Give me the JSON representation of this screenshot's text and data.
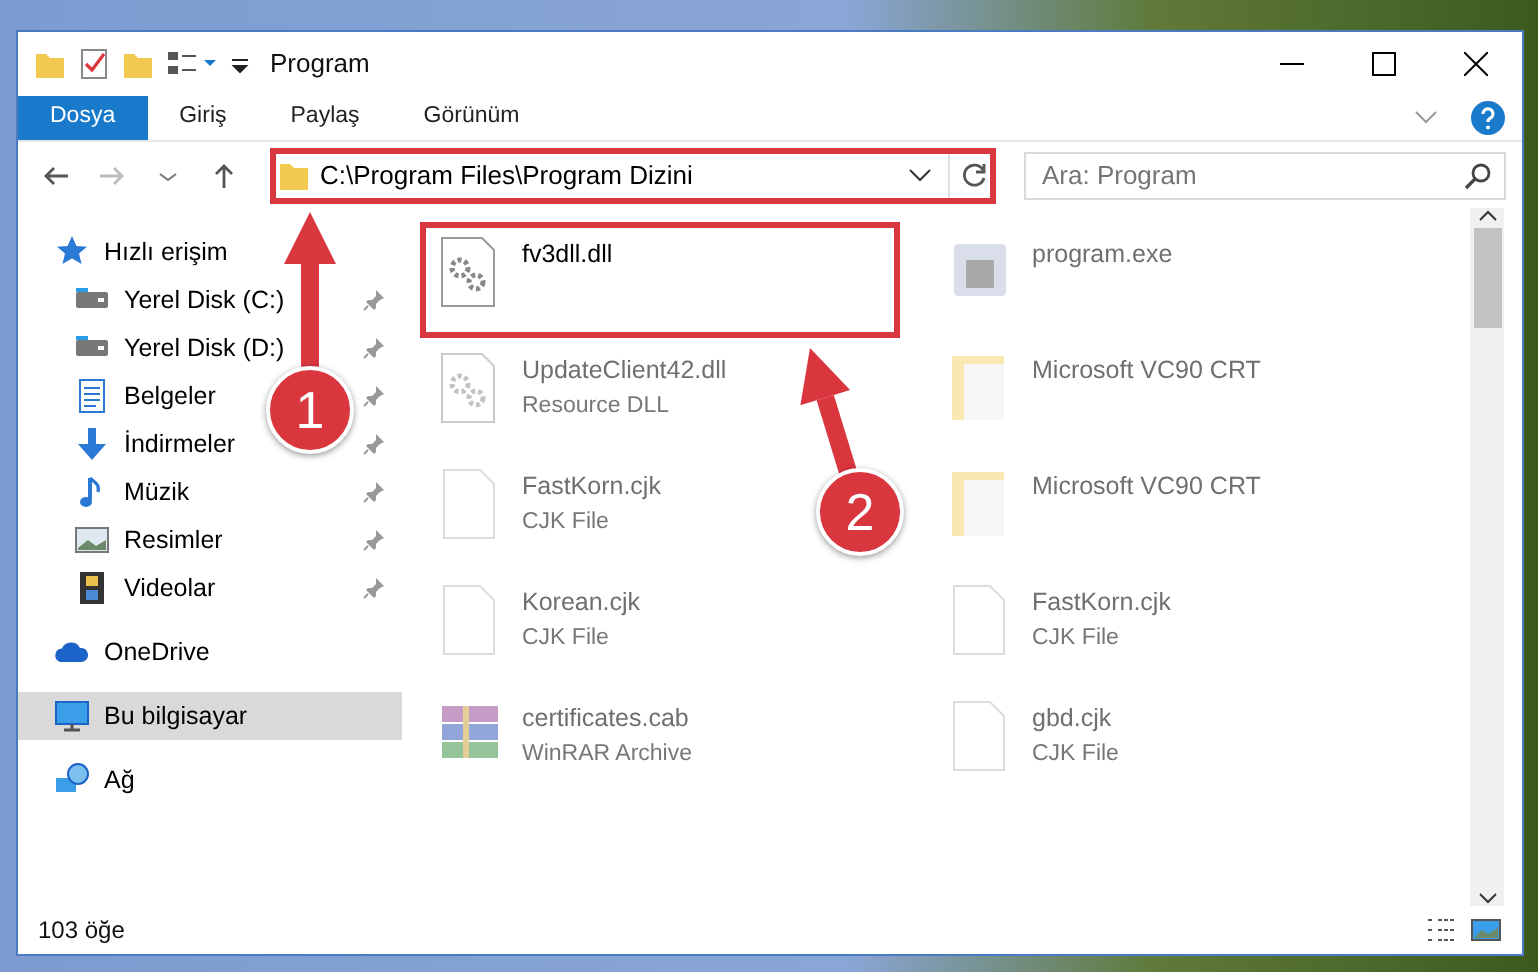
{
  "window": {
    "title": "Program"
  },
  "ribbon_tabs": [
    {
      "label": "Dosya",
      "selected": true
    },
    {
      "label": "Giriş",
      "selected": false
    },
    {
      "label": "Paylaş",
      "selected": false
    },
    {
      "label": "Görünüm",
      "selected": false
    }
  ],
  "address_bar": {
    "path": "C:\\Program Files\\Program Dizini",
    "highlighted": true
  },
  "search": {
    "placeholder": "Ara: Program"
  },
  "sidebar": {
    "items": [
      {
        "label": "Hızlı erişim",
        "selected": false,
        "children": [
          {
            "label": "Yerel Disk (C:)",
            "pinned": true
          },
          {
            "label": "Yerel Disk (D:)",
            "pinned": true
          },
          {
            "label": "Belgeler",
            "pinned": true
          },
          {
            "label": "İndirmeler",
            "pinned": true
          },
          {
            "label": "Müzik",
            "pinned": true
          },
          {
            "label": "Resimler",
            "pinned": true
          },
          {
            "label": "Videolar",
            "pinned": true
          }
        ]
      },
      {
        "label": "OneDrive",
        "selected": false
      },
      {
        "label": "Bu bilgisayar",
        "selected": true
      },
      {
        "label": "Ağ",
        "selected": false
      }
    ]
  },
  "files": [
    {
      "name": "fv3dll.dll",
      "kind": "dll",
      "dimmed": false,
      "highlighted": true
    },
    {
      "name": "program.exe",
      "kind": "exe",
      "dimmed": true,
      "highlighted": false
    },
    {
      "name": "UpdateClient42.dll",
      "type": "Resource DLL",
      "kind": "dll",
      "dimmed": true,
      "highlighted": false
    },
    {
      "name": "Microsoft VC90 CRT",
      "kind": "folder",
      "dimmed": true,
      "highlighted": false
    },
    {
      "name": "FastKorn.cjk",
      "type": "CJK File",
      "kind": "file",
      "dimmed": true,
      "highlighted": false
    },
    {
      "name": "Microsoft VC90 CRT",
      "kind": "folder",
      "dimmed": true,
      "highlighted": false
    },
    {
      "name": "Korean.cjk",
      "type": "CJK File",
      "kind": "file",
      "dimmed": true,
      "highlighted": false
    },
    {
      "name": "FastKorn.cjk",
      "type": "CJK File",
      "kind": "file",
      "dimmed": true,
      "highlighted": false
    },
    {
      "name": "certificates.cab",
      "type": "WinRAR Archive",
      "kind": "archive",
      "dimmed": true,
      "highlighted": false
    },
    {
      "name": "gbd.cjk",
      "type": "CJK File",
      "kind": "file",
      "dimmed": true,
      "highlighted": false
    }
  ],
  "annotations": [
    {
      "number": "1"
    },
    {
      "number": "2"
    }
  ],
  "status_bar": {
    "item_count": "103 öğe"
  }
}
